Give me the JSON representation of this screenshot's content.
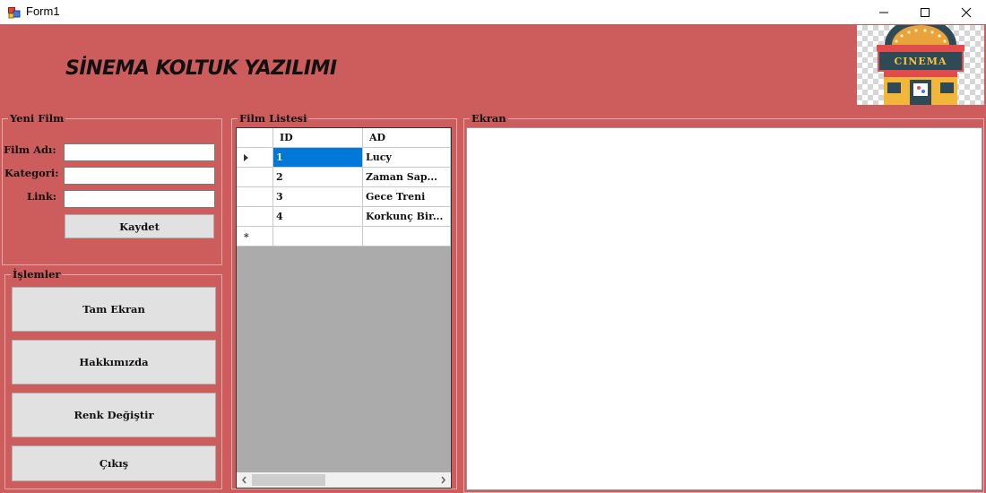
{
  "window": {
    "title": "Form1",
    "icon": "winforms-app-icon",
    "controls": [
      "minimize-icon",
      "maximize-icon",
      "close-icon"
    ]
  },
  "header": {
    "title": "SİNEMA KOLTUK YAZILIMI",
    "logo": "cinema-building-logo",
    "logo_text": "CINEMA"
  },
  "yeni_film": {
    "legend": "Yeni Film",
    "fields": {
      "film_adi_label": "Film Adı:",
      "film_adi_value": "",
      "kategori_label": "Kategori:",
      "kategori_value": "",
      "link_label": "Link:",
      "link_value": ""
    },
    "save_label": "Kaydet"
  },
  "islemler": {
    "legend": "İşlemler",
    "buttons": {
      "tam_ekran": "Tam Ekran",
      "hakkimizda": "Hakkımızda",
      "renk_degistir": "Renk Değiştir",
      "cikis": "Çıkış"
    }
  },
  "film_listesi": {
    "legend": "Film Listesi",
    "columns": [
      "ID",
      "AD"
    ],
    "rows": [
      {
        "id": "1",
        "ad": "Lucy"
      },
      {
        "id": "2",
        "ad": "Zaman Sap..."
      },
      {
        "id": "3",
        "ad": "Gece Treni"
      },
      {
        "id": "4",
        "ad": "Korkunç Bir..."
      }
    ],
    "new_row_marker": "*",
    "selected_row": 0
  },
  "ekran": {
    "legend": "Ekran"
  },
  "colors": {
    "form_background": "#cd5c5c",
    "selection": "#0078d7",
    "grid_background": "#ababab"
  }
}
